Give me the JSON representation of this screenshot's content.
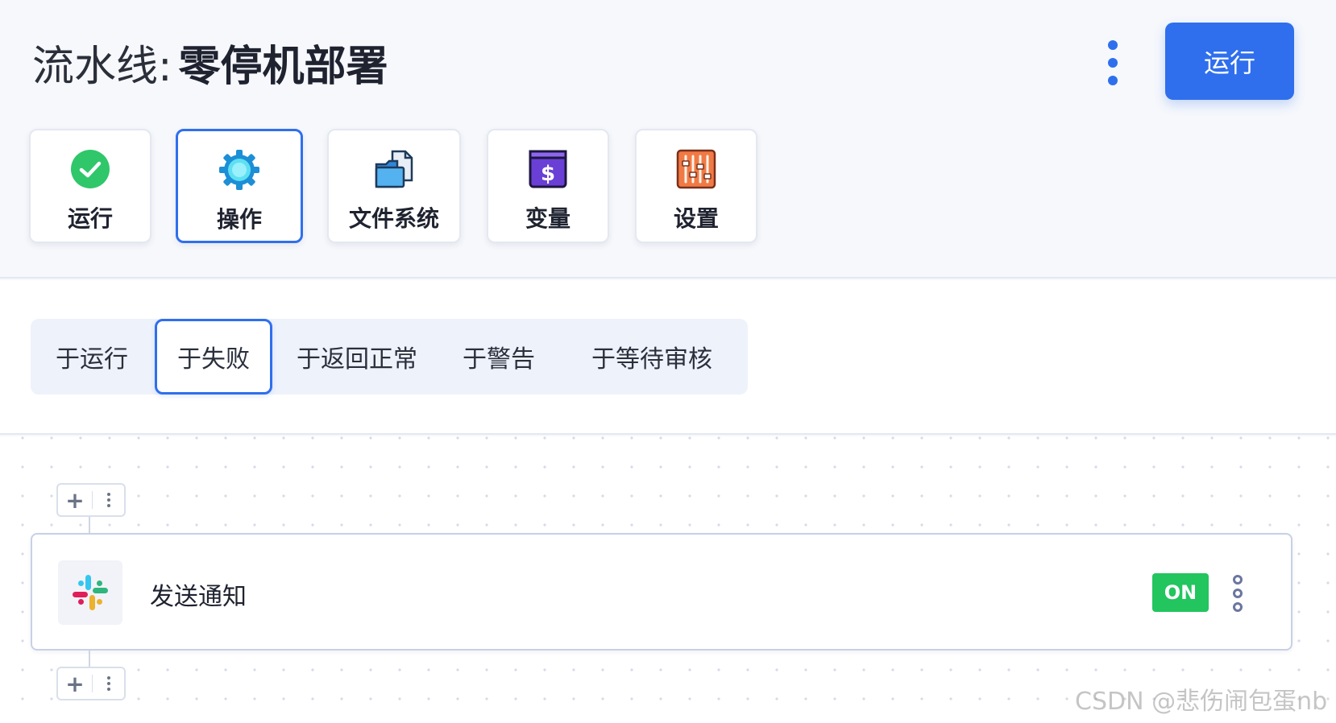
{
  "header": {
    "title_prefix": "流水线:",
    "title_name": "零停机部署",
    "run_button_label": "运行",
    "accent_color": "#2f6fed"
  },
  "toolbar": {
    "cards": [
      {
        "label": "运行",
        "icon": "check-circle-icon"
      },
      {
        "label": "操作",
        "icon": "gear-icon",
        "active": true
      },
      {
        "label": "文件系统",
        "icon": "files-icon"
      },
      {
        "label": "变量",
        "icon": "dollar-icon"
      },
      {
        "label": "设置",
        "icon": "sliders-icon"
      }
    ]
  },
  "tabs": {
    "items": [
      {
        "label": "于运行"
      },
      {
        "label": "于失败",
        "active": true
      },
      {
        "label": "于返回正常"
      },
      {
        "label": "于警告"
      },
      {
        "label": "于等待审核"
      }
    ]
  },
  "canvas": {
    "node": {
      "label": "发送通知",
      "icon": "slack-icon",
      "toggle_label": "ON",
      "toggle_color": "#22c55e"
    }
  },
  "watermark": {
    "text": "CSDN @悲伤闹包蛋nb"
  }
}
